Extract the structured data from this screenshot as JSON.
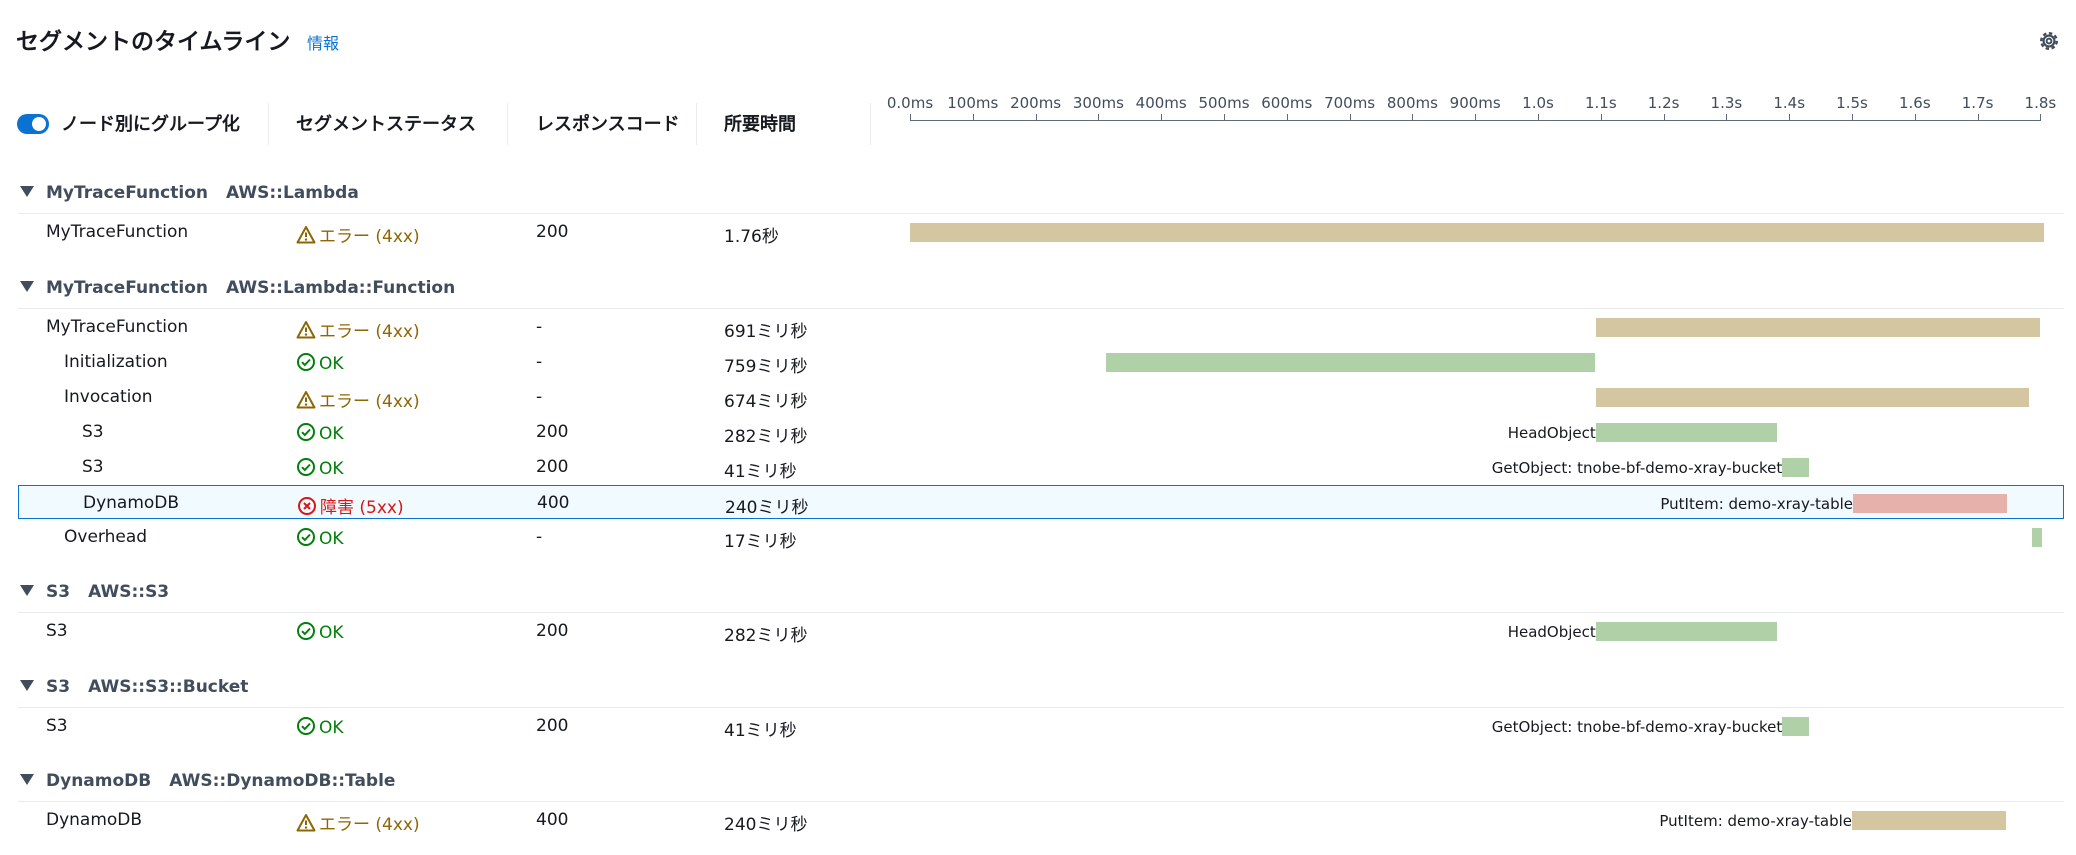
{
  "header": {
    "title": "セグメントのタイムライン",
    "info_link": "情報"
  },
  "columns": {
    "group_by_node_toggle": "ノード別にグループ化",
    "group_by_node_enabled": true,
    "segment_status": "セグメントステータス",
    "response_code": "レスポンスコード",
    "duration": "所要時間"
  },
  "timeline_axis": [
    "0.0ms",
    "100ms",
    "200ms",
    "300ms",
    "400ms",
    "500ms",
    "600ms",
    "700ms",
    "800ms",
    "900ms",
    "1.0s",
    "1.1s",
    "1.2s",
    "1.3s",
    "1.4s",
    "1.5s",
    "1.6s",
    "1.7s",
    "1.8s"
  ],
  "colors": {
    "bar_error": "#d5c6a2",
    "bar_ok": "#b0d1a8",
    "bar_fault": "#e6b1ab",
    "accent": "#0972d3"
  },
  "groups": [
    {
      "name": "MyTraceFunction",
      "type": "AWS::Lambda",
      "rows": [
        {
          "name": "MyTraceFunction",
          "indent": 0,
          "status": "エラー (4xx)",
          "status_kind": "warn",
          "code": "200",
          "duration": "1.76秒",
          "bar_start": 0.0,
          "bar_end": 1.805,
          "bar_label": "",
          "selected": false
        }
      ]
    },
    {
      "name": "MyTraceFunction",
      "type": "AWS::Lambda::Function",
      "rows": [
        {
          "name": "MyTraceFunction",
          "indent": 0,
          "status": "エラー (4xx)",
          "status_kind": "warn",
          "code": "-",
          "duration": "691ミリ秒",
          "bar_start": 1.092,
          "bar_end": 1.799,
          "bar_label": "",
          "selected": false
        },
        {
          "name": "Initialization",
          "indent": 1,
          "status": "OK",
          "status_kind": "ok",
          "code": "-",
          "duration": "759ミリ秒",
          "bar_start": 0.312,
          "bar_end": 1.09,
          "bar_label": "",
          "selected": false
        },
        {
          "name": "Invocation",
          "indent": 1,
          "status": "エラー (4xx)",
          "status_kind": "warn",
          "code": "-",
          "duration": "674ミリ秒",
          "bar_start": 1.092,
          "bar_end": 1.782,
          "bar_label": "",
          "selected": false
        },
        {
          "name": "S3",
          "indent": 2,
          "status": "OK",
          "status_kind": "ok",
          "code": "200",
          "duration": "282ミリ秒",
          "bar_start": 1.092,
          "bar_end": 1.381,
          "bar_label": "HeadObject",
          "selected": false
        },
        {
          "name": "S3",
          "indent": 2,
          "status": "OK",
          "status_kind": "ok",
          "code": "200",
          "duration": "41ミリ秒",
          "bar_start": 1.389,
          "bar_end": 1.431,
          "bar_label": "GetObject: tnobe-bf-demo-xray-bucket",
          "selected": false
        },
        {
          "name": "DynamoDB",
          "indent": 2,
          "status": "障害 (5xx)",
          "status_kind": "err",
          "code": "400",
          "duration": "240ミリ秒",
          "bar_start": 1.5,
          "bar_end": 1.746,
          "bar_label": "PutItem: demo-xray-table",
          "selected": true
        },
        {
          "name": "Overhead",
          "indent": 1,
          "status": "OK",
          "status_kind": "ok",
          "code": "-",
          "duration": "17ミリ秒",
          "bar_start": 1.786,
          "bar_end": 1.803,
          "bar_label": "",
          "selected": false
        }
      ]
    },
    {
      "name": "S3",
      "type": "AWS::S3",
      "rows": [
        {
          "name": "S3",
          "indent": 0,
          "status": "OK",
          "status_kind": "ok",
          "code": "200",
          "duration": "282ミリ秒",
          "bar_start": 1.092,
          "bar_end": 1.381,
          "bar_label": "HeadObject",
          "selected": false
        }
      ]
    },
    {
      "name": "S3",
      "type": "AWS::S3::Bucket",
      "rows": [
        {
          "name": "S3",
          "indent": 0,
          "status": "OK",
          "status_kind": "ok",
          "code": "200",
          "duration": "41ミリ秒",
          "bar_start": 1.389,
          "bar_end": 1.431,
          "bar_label": "GetObject: tnobe-bf-demo-xray-bucket",
          "selected": false
        }
      ]
    },
    {
      "name": "DynamoDB",
      "type": "AWS::DynamoDB::Table",
      "rows": [
        {
          "name": "DynamoDB",
          "indent": 0,
          "status": "エラー (4xx)",
          "status_kind": "warn",
          "code": "400",
          "duration": "240ミリ秒",
          "bar_start": 1.5,
          "bar_end": 1.746,
          "bar_label": "PutItem: demo-xray-table",
          "selected": false
        }
      ]
    }
  ]
}
